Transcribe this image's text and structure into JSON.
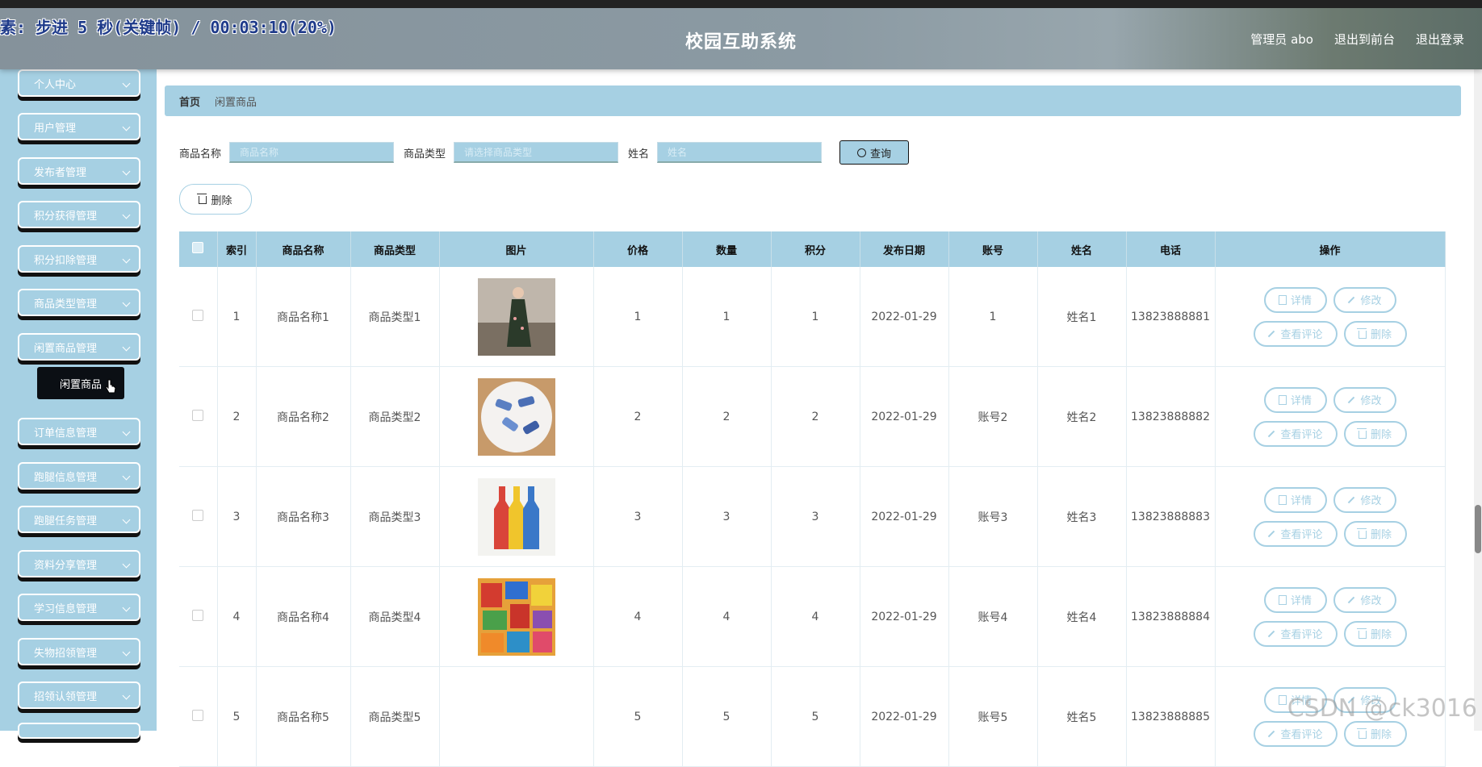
{
  "recording_overlay": "素: 步进 5 秒(关键帧) / 00:03:10(20%)",
  "header": {
    "title": "校园互助系统",
    "user_label": "管理员 abo",
    "front_link": "退出到前台",
    "logout_link": "退出登录"
  },
  "sidebar": {
    "items": [
      "个人中心",
      "用户管理",
      "发布者管理",
      "积分获得管理",
      "积分扣除管理",
      "商品类型管理",
      "闲置商品管理",
      "订单信息管理",
      "跑腿信息管理",
      "跑腿任务管理",
      "资料分享管理",
      "学习信息管理",
      "失物招领管理",
      "招领认领管理"
    ],
    "active_submenu": "闲置商品"
  },
  "breadcrumb": {
    "home": "首页",
    "current": "闲置商品"
  },
  "search": {
    "name_label": "商品名称",
    "name_placeholder": "商品名称",
    "type_label": "商品类型",
    "type_placeholder": "请选择商品类型",
    "person_label": "姓名",
    "person_placeholder": "姓名",
    "query_button": "查询"
  },
  "toolbar": {
    "delete_label": "删除"
  },
  "table": {
    "headers": [
      "索引",
      "商品名称",
      "商品类型",
      "图片",
      "价格",
      "数量",
      "积分",
      "发布日期",
      "账号",
      "姓名",
      "电话",
      "操作"
    ],
    "rows": [
      {
        "idx": "1",
        "name": "商品名称1",
        "type": "商品类型1",
        "price": "1",
        "qty": "1",
        "points": "1",
        "date": "2022-01-29",
        "account": "1",
        "person": "姓名1",
        "phone": "13823888881"
      },
      {
        "idx": "2",
        "name": "商品名称2",
        "type": "商品类型2",
        "price": "2",
        "qty": "2",
        "points": "2",
        "date": "2022-01-29",
        "account": "账号2",
        "person": "姓名2",
        "phone": "13823888882"
      },
      {
        "idx": "3",
        "name": "商品名称3",
        "type": "商品类型3",
        "price": "3",
        "qty": "3",
        "points": "3",
        "date": "2022-01-29",
        "account": "账号3",
        "person": "姓名3",
        "phone": "13823888883"
      },
      {
        "idx": "4",
        "name": "商品名称4",
        "type": "商品类型4",
        "price": "4",
        "qty": "4",
        "points": "4",
        "date": "2022-01-29",
        "account": "账号4",
        "person": "姓名4",
        "phone": "13823888884"
      },
      {
        "idx": "5",
        "name": "商品名称5",
        "type": "商品类型5",
        "price": "5",
        "qty": "5",
        "points": "5",
        "date": "2022-01-29",
        "account": "账号5",
        "person": "姓名5",
        "phone": "13823888885"
      }
    ],
    "actions": {
      "detail": "详情",
      "edit": "修改",
      "reviews": "查看评论",
      "delete": "删除"
    }
  },
  "watermark": "CSDN @ck3016"
}
